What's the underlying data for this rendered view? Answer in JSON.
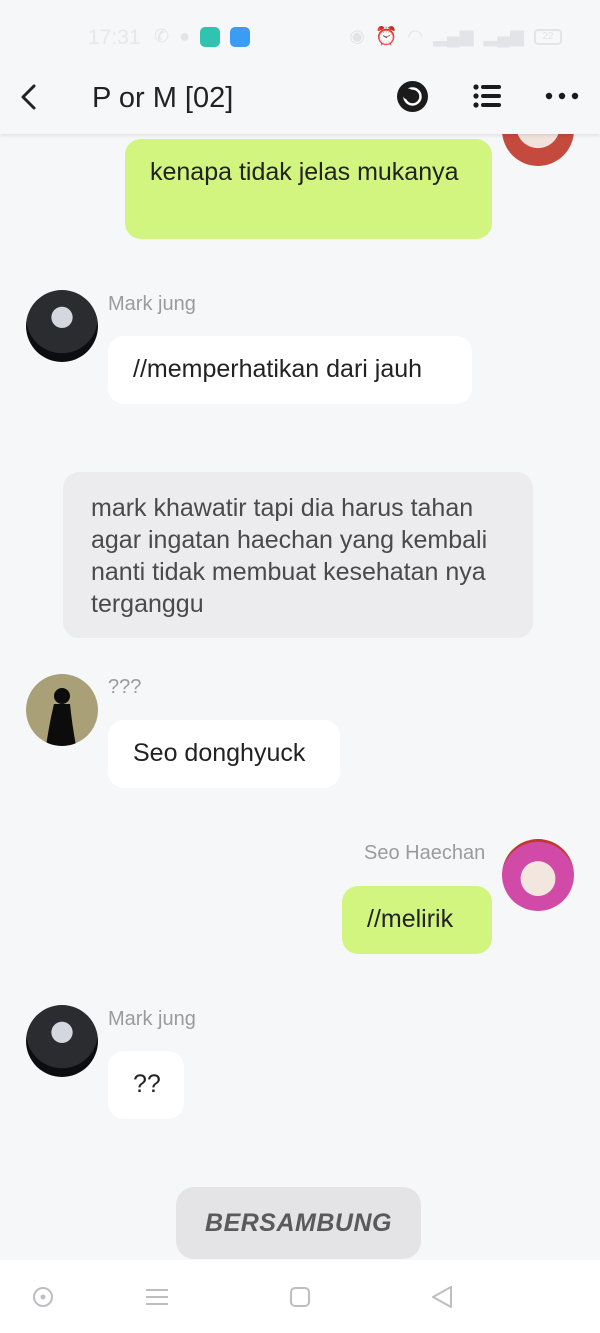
{
  "status_bar": {
    "time": "17:31",
    "battery": "22",
    "left_icons": [
      "whatsapp-icon",
      "notification-dot-icon",
      "app-icon-teal",
      "app-icon-blue"
    ],
    "right_icons": [
      "eye-icon",
      "alarm-icon",
      "wifi-icon",
      "signal-icon",
      "signal-icon",
      "battery-icon"
    ]
  },
  "header": {
    "title": "P or M [02]",
    "icons": [
      "back-arrow-icon",
      "moon-icon",
      "list-icon",
      "more-icon"
    ]
  },
  "messages": [
    {
      "type": "sent",
      "text": "kenapa tidak jelas mukanya",
      "color": "#d2f57f"
    },
    {
      "type": "received",
      "sender": "Mark jung",
      "text": "//memperhatikan dari jauh"
    },
    {
      "type": "narration",
      "text": "mark khawatir tapi dia harus tahan agar ingatan haechan yang kembali nanti tidak membuat kesehatan nya terganggu"
    },
    {
      "type": "received",
      "sender": "???",
      "text": "Seo donghyuck"
    },
    {
      "type": "sent",
      "sender": "Seo Haechan",
      "text": "//melirik",
      "color": "#d2f57f"
    },
    {
      "type": "received",
      "sender": "Mark jung",
      "text": "??"
    }
  ],
  "continue_button": {
    "label": "BERSAMBUNG"
  },
  "nav_bar": {
    "icons": [
      "circle-dot-icon",
      "menu-icon",
      "square-icon",
      "back-triangle-icon"
    ]
  }
}
